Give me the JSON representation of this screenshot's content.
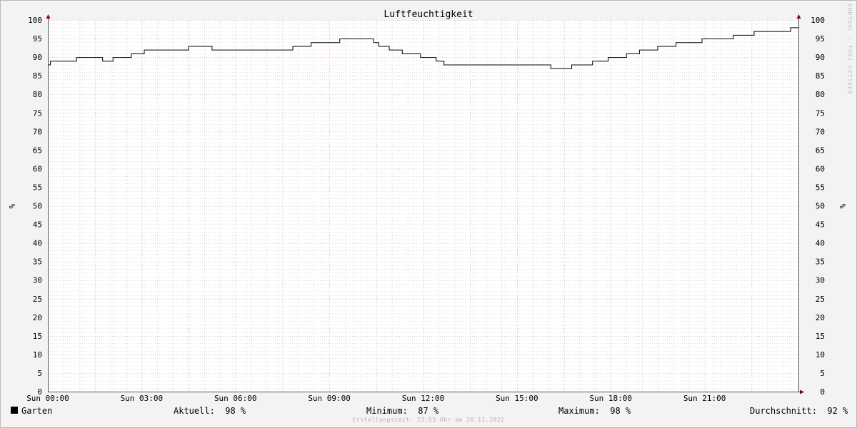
{
  "chart_data": {
    "type": "line",
    "title": "Luftfeuchtigkeit",
    "ylabel": "%",
    "ylabel_right": "%",
    "ylim": [
      0,
      100
    ],
    "y_ticks": [
      0,
      5,
      10,
      15,
      20,
      25,
      30,
      35,
      40,
      45,
      50,
      55,
      60,
      65,
      70,
      75,
      80,
      85,
      90,
      95,
      100
    ],
    "xlim": [
      "Sun 00:00",
      "Sun 24:00"
    ],
    "x_ticks": [
      "Sun 00:00",
      "Sun 03:00",
      "Sun 06:00",
      "Sun 09:00",
      "Sun 12:00",
      "Sun 15:00",
      "Sun 18:00",
      "Sun 21:00"
    ],
    "grid": true,
    "legend": "bottom-left",
    "watermark": "RRDTOOL / TOBI OETIKER",
    "series": [
      {
        "name": "Garten",
        "color": "#000000",
        "x": [
          "00:00",
          "00:05",
          "00:55",
          "01:45",
          "02:05",
          "02:40",
          "03:05",
          "04:30",
          "05:15",
          "05:20",
          "05:30",
          "07:50",
          "08:25",
          "09:20",
          "10:25",
          "10:35",
          "10:55",
          "11:20",
          "11:55",
          "12:25",
          "12:40",
          "13:05",
          "16:05",
          "16:45",
          "17:25",
          "17:55",
          "18:30",
          "18:55",
          "19:30",
          "20:05",
          "20:55",
          "21:55",
          "22:35",
          "23:45",
          "24:00"
        ],
        "values": [
          88,
          89,
          90,
          89,
          90,
          91,
          92,
          93,
          92,
          92,
          92,
          93,
          94,
          95,
          94,
          93,
          92,
          91,
          90,
          89,
          88,
          88,
          87,
          88,
          89,
          90,
          91,
          92,
          93,
          94,
          95,
          96,
          97,
          98,
          98
        ]
      }
    ]
  },
  "legend": {
    "series_name": "Garten",
    "current_label": "Aktuell:",
    "current_value": "98 %",
    "minimum_label": "Minimum:",
    "minimum_value": "87 %",
    "maximum_label": "Maximum:",
    "maximum_value": "98 %",
    "average_label": "Durchschnitt:",
    "average_value": "92 %"
  },
  "footer": {
    "text": "Erstellungszeit: 23:55 Uhr am 20.11.2022"
  },
  "colors": {
    "background": "#f3f3f3",
    "canvas": "#ffffff",
    "major_grid": "#e89b9b",
    "minor_grid": "#c8c8c8",
    "axis": "#555555",
    "arrow": "#8b0000",
    "line": "#000000"
  }
}
